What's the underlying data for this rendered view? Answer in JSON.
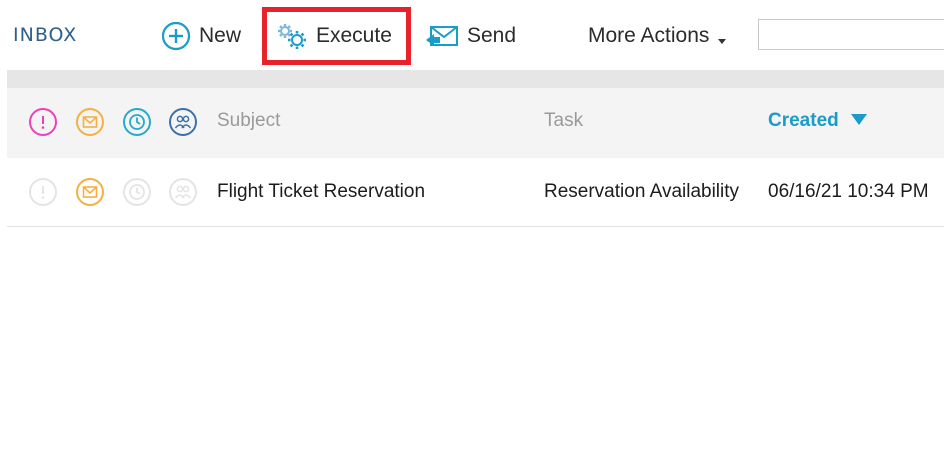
{
  "toolbar": {
    "title": "INBOX",
    "new_label": "New",
    "execute_label": "Execute",
    "send_label": "Send",
    "more_label": "More Actions",
    "search_value": "",
    "highlight_color": "#e8222b"
  },
  "table": {
    "headers": {
      "subject": "Subject",
      "task": "Task",
      "created": "Created",
      "created_sort": "descending"
    },
    "rows": [
      {
        "subject": "Flight Ticket Reservation",
        "task": "Reservation Availability",
        "created": "06/16/21 10:34 PM",
        "icons": [
          "priority-icon-inactive",
          "message-icon-active",
          "clock-icon-inactive",
          "group-icon-inactive"
        ]
      }
    ]
  },
  "icons": {
    "priority_color": "#ef3fb8",
    "message_color": "#f5b041",
    "clock_color": "#27aac8",
    "group_color": "#3d6fa8",
    "inactive_color": "#e4e4e4"
  }
}
